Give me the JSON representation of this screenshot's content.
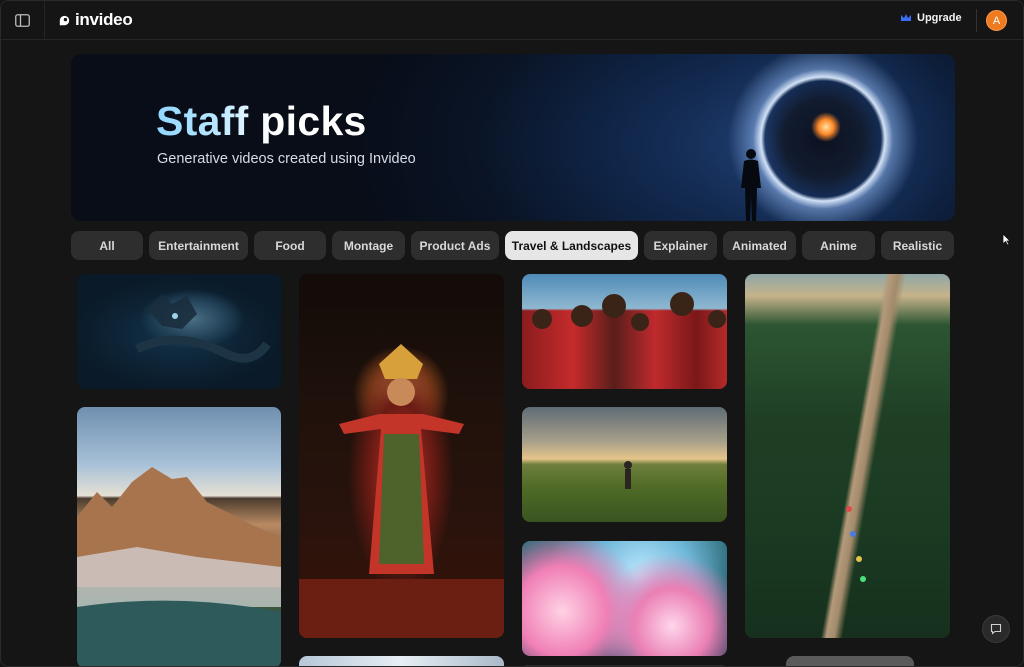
{
  "brand": {
    "name": "invideo",
    "logo_icon": "invideo-logo-icon"
  },
  "header": {
    "upgrade_label": "Upgrade",
    "upgrade_icon": "crown-icon",
    "avatar_initial": "A",
    "sidebar_toggle_icon": "sidebar-toggle-icon"
  },
  "hero": {
    "title": "Staff picks",
    "subtitle": "Generative videos created using Invideo"
  },
  "categories": [
    {
      "label": "All",
      "active": false
    },
    {
      "label": "Entertainment",
      "active": false
    },
    {
      "label": "Food",
      "active": false
    },
    {
      "label": "Montage",
      "active": false
    },
    {
      "label": "Product Ads",
      "active": false
    },
    {
      "label": "Travel & Landscapes",
      "active": true
    },
    {
      "label": "Explainer",
      "active": false
    },
    {
      "label": "Animated",
      "active": false
    },
    {
      "label": "Anime",
      "active": false
    },
    {
      "label": "Realistic",
      "active": false
    }
  ],
  "gallery": [
    {
      "subject": "dragon"
    },
    {
      "subject": "mountain"
    },
    {
      "subject": "dancer"
    },
    {
      "subject": "maasai"
    },
    {
      "subject": "meadow"
    },
    {
      "subject": "flowers"
    },
    {
      "subject": "forest"
    }
  ],
  "colors": {
    "background": "#151515",
    "chip": "#2e2e2e",
    "chip_active": "#e6e6e6",
    "avatar": "#f07a1e",
    "upgrade_crown": "#3b6df0"
  }
}
